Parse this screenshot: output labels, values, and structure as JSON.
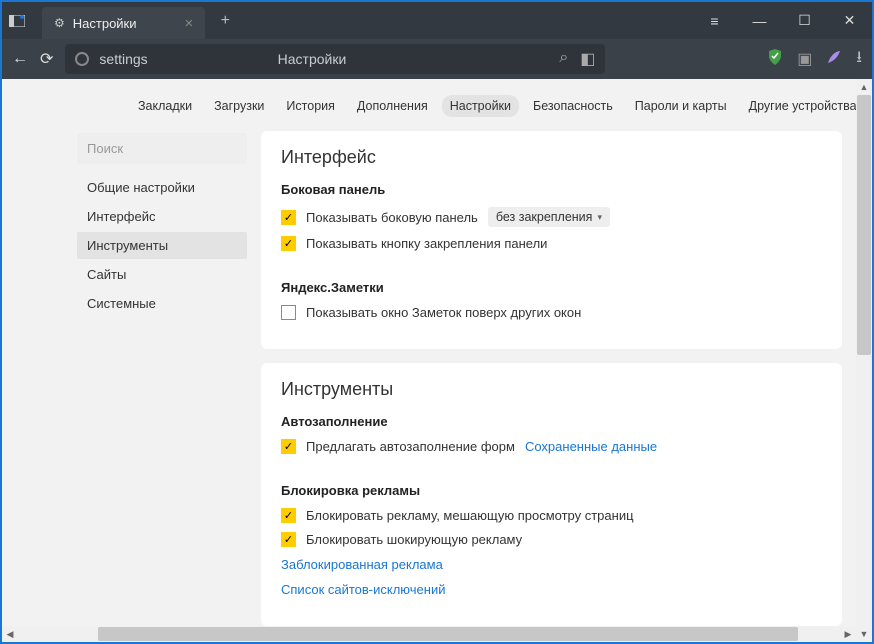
{
  "titlebar": {
    "tab_title": "Настройки",
    "tab_close": "×",
    "newtab": "+",
    "win": {
      "menu": "≡",
      "min": "—",
      "max": "☐",
      "close": "✕"
    }
  },
  "addr": {
    "back": "←",
    "reload": "⟳",
    "url_text": "settings",
    "page_title": "Настройки",
    "search_icon": "⌕",
    "bookmark": "◧",
    "shield": "◆",
    "user": "▣",
    "feather": "✎",
    "download": "⭳"
  },
  "tabs": {
    "items": [
      "Закладки",
      "Загрузки",
      "История",
      "Дополнения",
      "Настройки",
      "Безопасность",
      "Пароли и карты",
      "Другие устройства"
    ],
    "active_index": 4
  },
  "sidebar": {
    "search_placeholder": "Поиск",
    "items": [
      "Общие настройки",
      "Интерфейс",
      "Инструменты",
      "Сайты",
      "Системные"
    ],
    "active_index": 2
  },
  "card_interface": {
    "title": "Интерфейс",
    "side_panel": {
      "label": "Боковая панель",
      "opt1": "Показывать боковую панель",
      "dd_value": "без закрепления",
      "opt2": "Показывать кнопку закрепления панели"
    },
    "notes": {
      "label": "Яндекс.Заметки",
      "opt1": "Показывать окно Заметок поверх других окон"
    }
  },
  "card_tools": {
    "title": "Инструменты",
    "autofill": {
      "label": "Автозаполнение",
      "opt1": "Предлагать автозаполнение форм",
      "link": "Сохраненные данные"
    },
    "adblock": {
      "label": "Блокировка рекламы",
      "opt1": "Блокировать рекламу, мешающую просмотру страниц",
      "opt2": "Блокировать шокирующую рекламу",
      "link1": "Заблокированная реклама",
      "link2": "Список сайтов-исключений"
    }
  }
}
